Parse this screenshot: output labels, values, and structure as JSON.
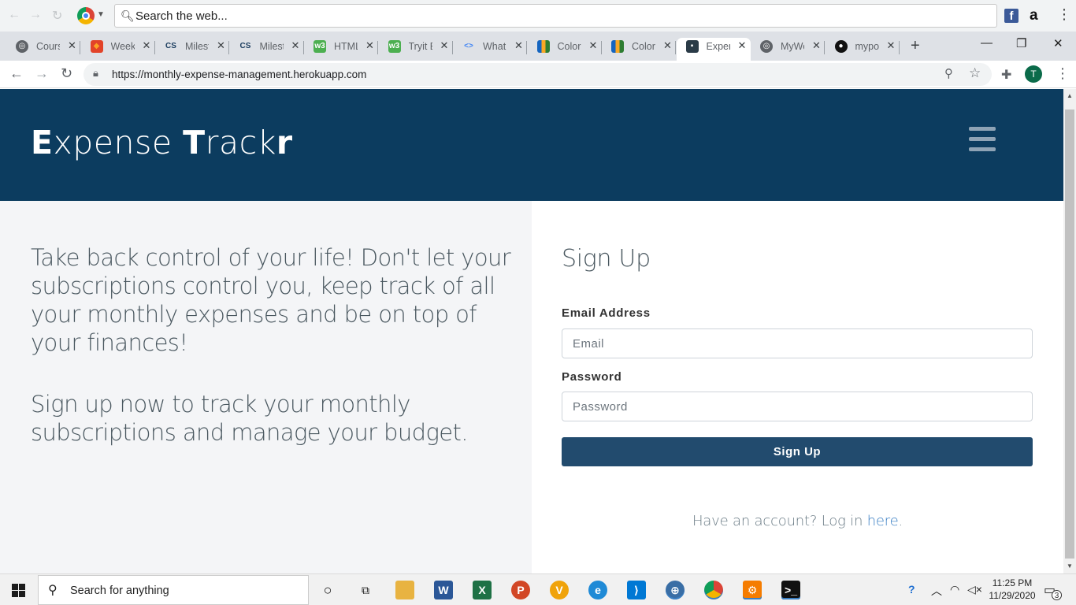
{
  "browser": {
    "search_placeholder": "Search the web...",
    "url": "https://monthly-expense-management.herokuapp.com",
    "profile_initial": "T",
    "tabs": [
      {
        "title": "Cours",
        "icon": "globe-icon"
      },
      {
        "title": "Week",
        "icon": "gitlab-icon"
      },
      {
        "title": "Milest",
        "icon": "cs-icon"
      },
      {
        "title": "Milest",
        "icon": "cs-icon"
      },
      {
        "title": "HTML",
        "icon": "w3schools-icon"
      },
      {
        "title": "Tryit E",
        "icon": "w3schools-icon"
      },
      {
        "title": "What",
        "icon": "code-icon"
      },
      {
        "title": "Color",
        "icon": "palette-icon"
      },
      {
        "title": "Color",
        "icon": "palette-icon"
      },
      {
        "title": "Exper",
        "icon": "money-icon",
        "active": true
      },
      {
        "title": "MyWe",
        "icon": "globe-icon"
      },
      {
        "title": "mypo",
        "icon": "github-icon"
      }
    ],
    "tab_close": "✕",
    "new_tab": "+",
    "window_controls": {
      "minimize": "—",
      "maximize": "❐",
      "close": "✕"
    }
  },
  "site": {
    "brand": {
      "e": "E",
      "xpense": "xpense ",
      "t": "T",
      "rack": "rack",
      "r": "r"
    },
    "intro_1": "Take back control of your life! Don't let your subscriptions control you, keep track of all your monthly expenses and be on top of your finances!",
    "intro_2": "Sign up now to track your monthly subscriptions and manage your budget.",
    "form": {
      "title": "Sign Up",
      "email_label": "Email Address",
      "email_placeholder": "Email",
      "email_value": "",
      "password_label": "Password",
      "password_placeholder": "Password",
      "password_value": "",
      "submit": "Sign Up",
      "login_prefix": "Have an account? Log in ",
      "login_link": "here",
      "login_suffix": "."
    },
    "colors": {
      "header": "#0c3c5f",
      "button": "#224b6e",
      "link": "#3a7fc4"
    }
  },
  "taskbar": {
    "search_placeholder": "Search for anything",
    "time": "11:25 PM",
    "date": "11/29/2020",
    "notification_count": "3"
  }
}
